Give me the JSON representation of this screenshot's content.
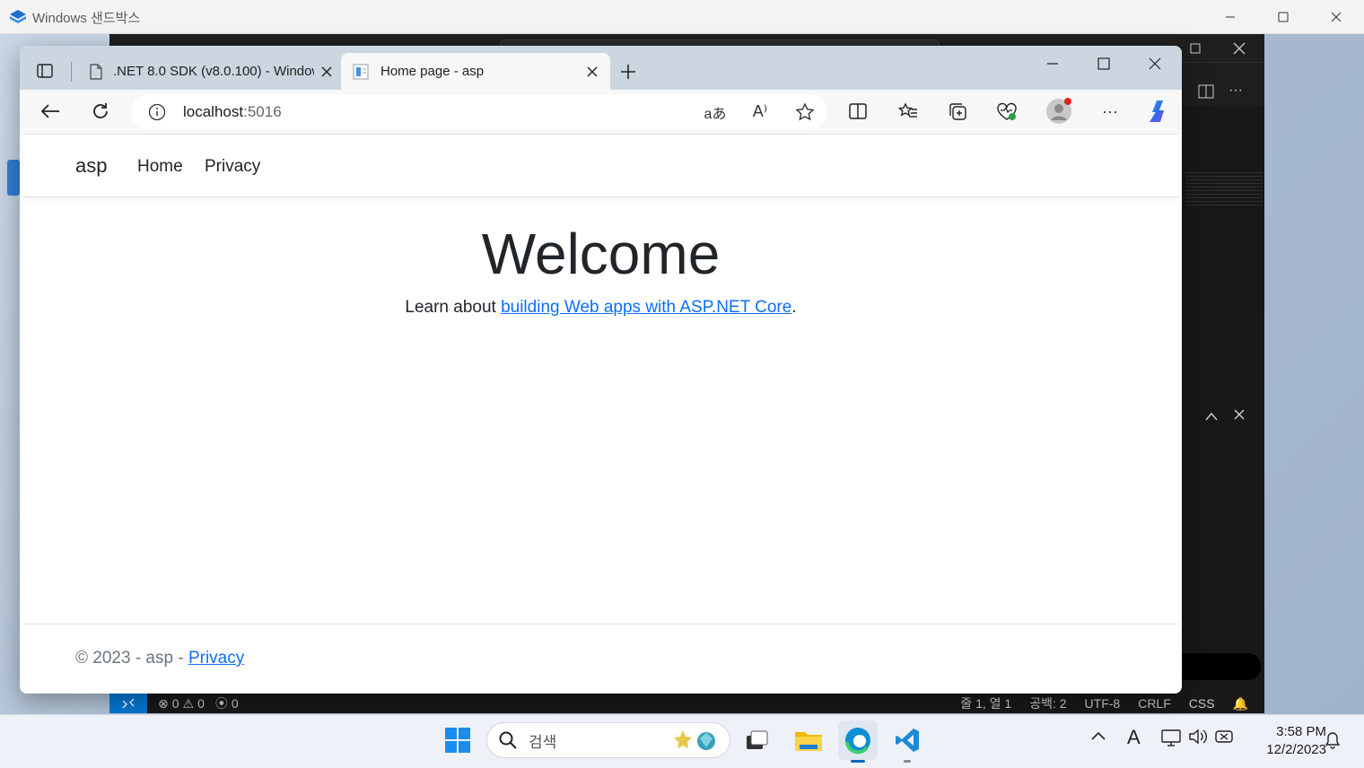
{
  "sandbox": {
    "title": "Windows 샌드박스"
  },
  "browser": {
    "tabs": [
      {
        "title": ".NET 8.0 SDK (v8.0.100) - Windows"
      },
      {
        "title": "Home page - asp"
      }
    ],
    "address": {
      "host": "localhost",
      "port": ":5016"
    }
  },
  "site": {
    "brand": "asp",
    "nav": [
      "Home",
      "Privacy"
    ],
    "heading": "Welcome",
    "learn_prefix": "Learn about ",
    "learn_link": "building Web apps with ASP.NET Core",
    "learn_suffix": ".",
    "footer_prefix": "© 2023 - asp - ",
    "footer_link": "Privacy"
  },
  "vscode": {
    "status": {
      "errors": "0",
      "warnings": "0",
      "ports": "0",
      "position": "줄 1, 열 1",
      "spaces": "공백: 2",
      "encoding": "UTF-8",
      "eol": "CRLF",
      "language": "CSS"
    }
  },
  "taskbar": {
    "search_placeholder": "검색",
    "time": "3:58 PM",
    "date": "12/2/2023"
  },
  "colors": {
    "link": "#0d6efd",
    "accent": "#0078d4"
  }
}
